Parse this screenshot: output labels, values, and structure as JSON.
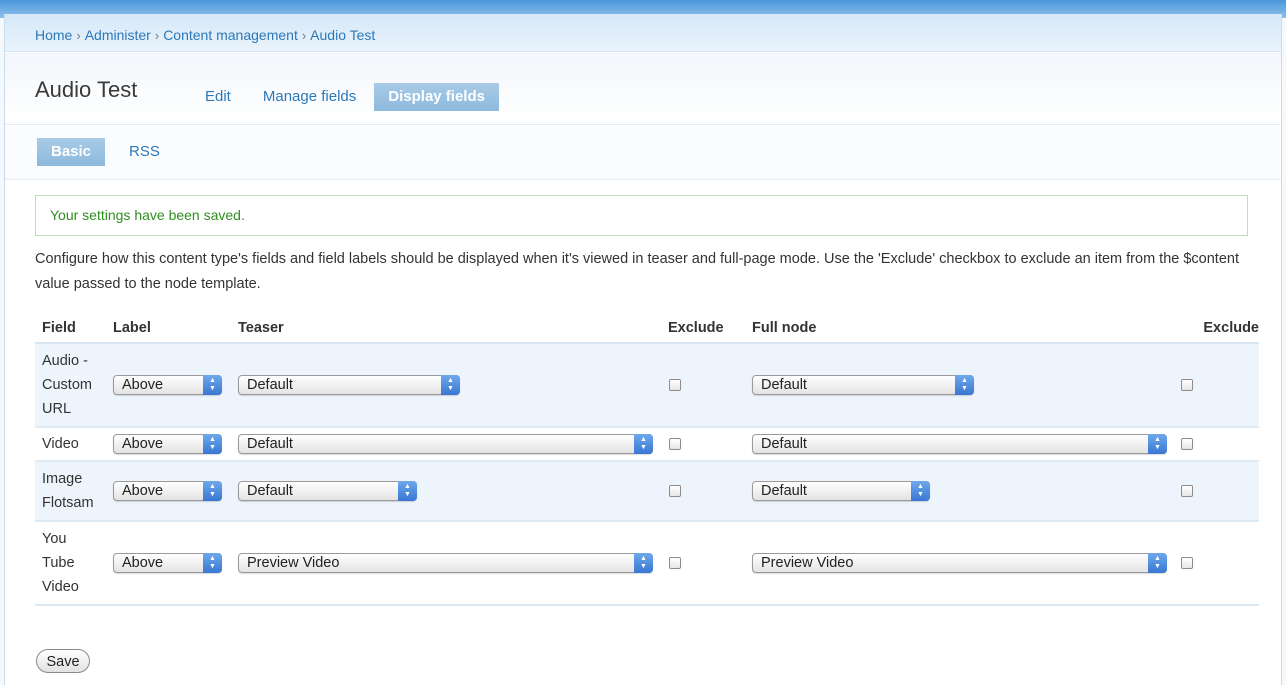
{
  "breadcrumb": [
    "Home",
    "Administer",
    "Content management",
    "Audio Test"
  ],
  "page_title": "Audio Test",
  "tabs": [
    {
      "label": "Edit",
      "active": false
    },
    {
      "label": "Manage fields",
      "active": false
    },
    {
      "label": "Display fields",
      "active": true
    }
  ],
  "subtabs": [
    {
      "label": "Basic",
      "active": true
    },
    {
      "label": "RSS",
      "active": false
    }
  ],
  "status_message": "Your settings have been saved.",
  "description": "Configure how this content type's fields and field labels should be displayed when it's viewed in teaser and full-page mode. Use the 'Exclude' checkbox to exclude an item from the $content value passed to the node template.",
  "table": {
    "headers": {
      "field": "Field",
      "label": "Label",
      "teaser": "Teaser",
      "exclude_teaser": "Exclude",
      "full": "Full node",
      "exclude_full": "Exclude"
    },
    "rows": [
      {
        "field": "Audio - Custom URL",
        "label": "Above",
        "teaser": "Default",
        "exclude_teaser": false,
        "full": "Default",
        "exclude_full": false
      },
      {
        "field": "Video",
        "label": "Above",
        "teaser": "Default",
        "exclude_teaser": false,
        "full": "Default",
        "exclude_full": false
      },
      {
        "field": "Image Flotsam",
        "label": "Above",
        "teaser": "Default",
        "exclude_teaser": false,
        "full": "Default",
        "exclude_full": false
      },
      {
        "field": "You Tube Video",
        "label": "Above",
        "teaser": "Preview Video",
        "exclude_teaser": false,
        "full": "Preview Video",
        "exclude_full": false
      }
    ]
  },
  "save_label": "Save",
  "colors": {
    "link": "#2c78b8",
    "active_tab": "#8db9dd",
    "status_text": "#2f8f1f",
    "select_arrow": "#3877d4"
  }
}
